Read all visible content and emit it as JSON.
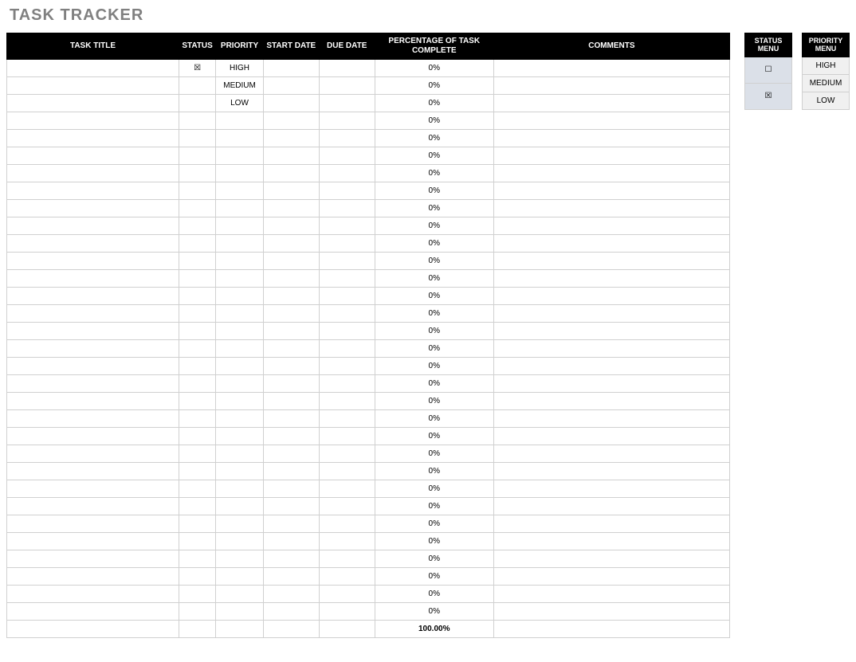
{
  "title": "TASK TRACKER",
  "headers": {
    "task_title": "TASK TITLE",
    "status": "STATUS",
    "priority": "PRIORITY",
    "start_date": "START DATE",
    "due_date": "DUE DATE",
    "pct": "PERCENTAGE OF TASK COMPLETE",
    "comments": "COMMENTS"
  },
  "rows": [
    {
      "title": "",
      "status": "☒",
      "priority": "HIGH",
      "start": "",
      "due": "",
      "pct": "0%",
      "comments": ""
    },
    {
      "title": "",
      "status": "",
      "priority": "MEDIUM",
      "start": "",
      "due": "",
      "pct": "0%",
      "comments": ""
    },
    {
      "title": "",
      "status": "",
      "priority": "LOW",
      "start": "",
      "due": "",
      "pct": "0%",
      "comments": ""
    },
    {
      "title": "",
      "status": "",
      "priority": "",
      "start": "",
      "due": "",
      "pct": "0%",
      "comments": ""
    },
    {
      "title": "",
      "status": "",
      "priority": "",
      "start": "",
      "due": "",
      "pct": "0%",
      "comments": ""
    },
    {
      "title": "",
      "status": "",
      "priority": "",
      "start": "",
      "due": "",
      "pct": "0%",
      "comments": ""
    },
    {
      "title": "",
      "status": "",
      "priority": "",
      "start": "",
      "due": "",
      "pct": "0%",
      "comments": ""
    },
    {
      "title": "",
      "status": "",
      "priority": "",
      "start": "",
      "due": "",
      "pct": "0%",
      "comments": ""
    },
    {
      "title": "",
      "status": "",
      "priority": "",
      "start": "",
      "due": "",
      "pct": "0%",
      "comments": ""
    },
    {
      "title": "",
      "status": "",
      "priority": "",
      "start": "",
      "due": "",
      "pct": "0%",
      "comments": ""
    },
    {
      "title": "",
      "status": "",
      "priority": "",
      "start": "",
      "due": "",
      "pct": "0%",
      "comments": ""
    },
    {
      "title": "",
      "status": "",
      "priority": "",
      "start": "",
      "due": "",
      "pct": "0%",
      "comments": ""
    },
    {
      "title": "",
      "status": "",
      "priority": "",
      "start": "",
      "due": "",
      "pct": "0%",
      "comments": ""
    },
    {
      "title": "",
      "status": "",
      "priority": "",
      "start": "",
      "due": "",
      "pct": "0%",
      "comments": ""
    },
    {
      "title": "",
      "status": "",
      "priority": "",
      "start": "",
      "due": "",
      "pct": "0%",
      "comments": ""
    },
    {
      "title": "",
      "status": "",
      "priority": "",
      "start": "",
      "due": "",
      "pct": "0%",
      "comments": ""
    },
    {
      "title": "",
      "status": "",
      "priority": "",
      "start": "",
      "due": "",
      "pct": "0%",
      "comments": ""
    },
    {
      "title": "",
      "status": "",
      "priority": "",
      "start": "",
      "due": "",
      "pct": "0%",
      "comments": ""
    },
    {
      "title": "",
      "status": "",
      "priority": "",
      "start": "",
      "due": "",
      "pct": "0%",
      "comments": ""
    },
    {
      "title": "",
      "status": "",
      "priority": "",
      "start": "",
      "due": "",
      "pct": "0%",
      "comments": ""
    },
    {
      "title": "",
      "status": "",
      "priority": "",
      "start": "",
      "due": "",
      "pct": "0%",
      "comments": ""
    },
    {
      "title": "",
      "status": "",
      "priority": "",
      "start": "",
      "due": "",
      "pct": "0%",
      "comments": ""
    },
    {
      "title": "",
      "status": "",
      "priority": "",
      "start": "",
      "due": "",
      "pct": "0%",
      "comments": ""
    },
    {
      "title": "",
      "status": "",
      "priority": "",
      "start": "",
      "due": "",
      "pct": "0%",
      "comments": ""
    },
    {
      "title": "",
      "status": "",
      "priority": "",
      "start": "",
      "due": "",
      "pct": "0%",
      "comments": ""
    },
    {
      "title": "",
      "status": "",
      "priority": "",
      "start": "",
      "due": "",
      "pct": "0%",
      "comments": ""
    },
    {
      "title": "",
      "status": "",
      "priority": "",
      "start": "",
      "due": "",
      "pct": "0%",
      "comments": ""
    },
    {
      "title": "",
      "status": "",
      "priority": "",
      "start": "",
      "due": "",
      "pct": "0%",
      "comments": ""
    },
    {
      "title": "",
      "status": "",
      "priority": "",
      "start": "",
      "due": "",
      "pct": "0%",
      "comments": ""
    },
    {
      "title": "",
      "status": "",
      "priority": "",
      "start": "",
      "due": "",
      "pct": "0%",
      "comments": ""
    },
    {
      "title": "",
      "status": "",
      "priority": "",
      "start": "",
      "due": "",
      "pct": "0%",
      "comments": ""
    },
    {
      "title": "",
      "status": "",
      "priority": "",
      "start": "",
      "due": "",
      "pct": "0%",
      "comments": ""
    }
  ],
  "total": "100.00%",
  "status_menu": {
    "header": "STATUS MENU",
    "items": [
      "☐",
      "☒"
    ]
  },
  "priority_menu": {
    "header": "PRIORITY MENU",
    "items": [
      "HIGH",
      "MEDIUM",
      "LOW"
    ]
  }
}
